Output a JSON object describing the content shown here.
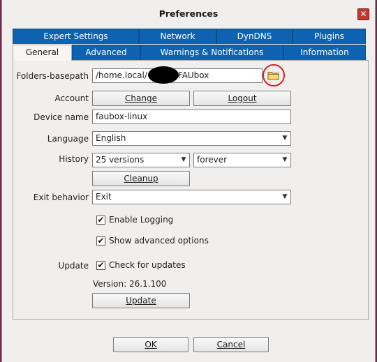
{
  "window": {
    "title": "Preferences"
  },
  "tabs_top": [
    {
      "label": "Expert Settings"
    },
    {
      "label": "Network"
    },
    {
      "label": "DynDNS"
    },
    {
      "label": "Plugins"
    }
  ],
  "tabs_bottom": [
    {
      "label": "General"
    },
    {
      "label": "Advanced"
    },
    {
      "label": "Warnings & Notifications"
    },
    {
      "label": "Information"
    }
  ],
  "general": {
    "folders_basepath": {
      "label": "Folders-basepath",
      "value_start": "/home.local/",
      "value_end": "FAUbox"
    },
    "account": {
      "label": "Account",
      "change": "Change",
      "logout": "Logout"
    },
    "device_name": {
      "label": "Device name",
      "value": "faubox-linux"
    },
    "language": {
      "label": "Language",
      "value": "English"
    },
    "history": {
      "label": "History",
      "versions": "25 versions",
      "duration": "forever",
      "cleanup": "Cleanup"
    },
    "exit_behavior": {
      "label": "Exit behavior",
      "value": "Exit"
    },
    "enable_logging": {
      "label": "Enable Logging",
      "checked": true
    },
    "show_advanced": {
      "label": "Show advanced options",
      "checked": true
    },
    "update": {
      "label": "Update",
      "check_label": "Check for updates",
      "checked": true,
      "version": "Version: 26.1.100",
      "button": "Update"
    }
  },
  "footer": {
    "ok": "OK",
    "cancel": "Cancel"
  },
  "colors": {
    "tab_blue": "#0d63b2",
    "annotation_red": "#e02020"
  }
}
